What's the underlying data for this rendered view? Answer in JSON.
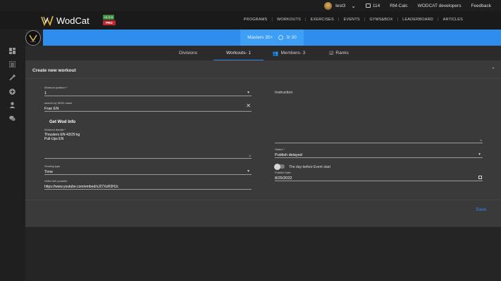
{
  "topbar": {
    "username": "test3",
    "coins": "114",
    "links": [
      "RM-Calc",
      "WODCAT developers",
      "Feedback"
    ]
  },
  "header": {
    "logo_text": "WodCat",
    "version": "v1.0.6",
    "pro_badge": "PRO",
    "nav": [
      "PROGRAMS",
      "WORKOUTS",
      "EXERCISES",
      "EVENTS",
      "GYMS&BOX",
      "LEADERBOARD",
      "ARTICLES"
    ]
  },
  "sidebar": {
    "icons": [
      "dashboard-icon",
      "list-icon",
      "tools-icon",
      "add-circle-icon",
      "person-icon",
      "chat-icon"
    ]
  },
  "banner": {
    "division": "Masters 35+",
    "progress": "3/ 30"
  },
  "tabs": {
    "divisions": "Divisions",
    "workouts": "Workouts- 1",
    "members": "Members- 3",
    "ranks": "Ranks"
  },
  "form": {
    "title": "Create new workout",
    "workout_position": {
      "label": "Workout position *",
      "value": "1"
    },
    "wod_search": {
      "label": "search by WOD name",
      "value": "Fran EN"
    },
    "get_wod": "Get Wod Info",
    "workout_details": {
      "label": "Workout details *",
      "lines": [
        "Thrusters EN-43/29 kg",
        "Pull-Ups EN"
      ]
    },
    "scoring_type": {
      "label": "Scoring type",
      "value": "Time"
    },
    "video_link": {
      "label": "Video link youtube",
      "value": "https://www.youtube.com/embed/xJ27XzR3HJc"
    },
    "instruction": {
      "label": "Instruction"
    },
    "status": {
      "label": "Status *",
      "value": "Publish delayed"
    },
    "toggle_label": "The day before Event start",
    "publish_date": {
      "label": "Publish Date",
      "value": "8/25/2022"
    },
    "save_label": "Save"
  },
  "colors": {
    "accent": "#2f8ded",
    "pro": "#c0262d",
    "version": "#3d8b3d",
    "card": "#3a3a3a"
  }
}
